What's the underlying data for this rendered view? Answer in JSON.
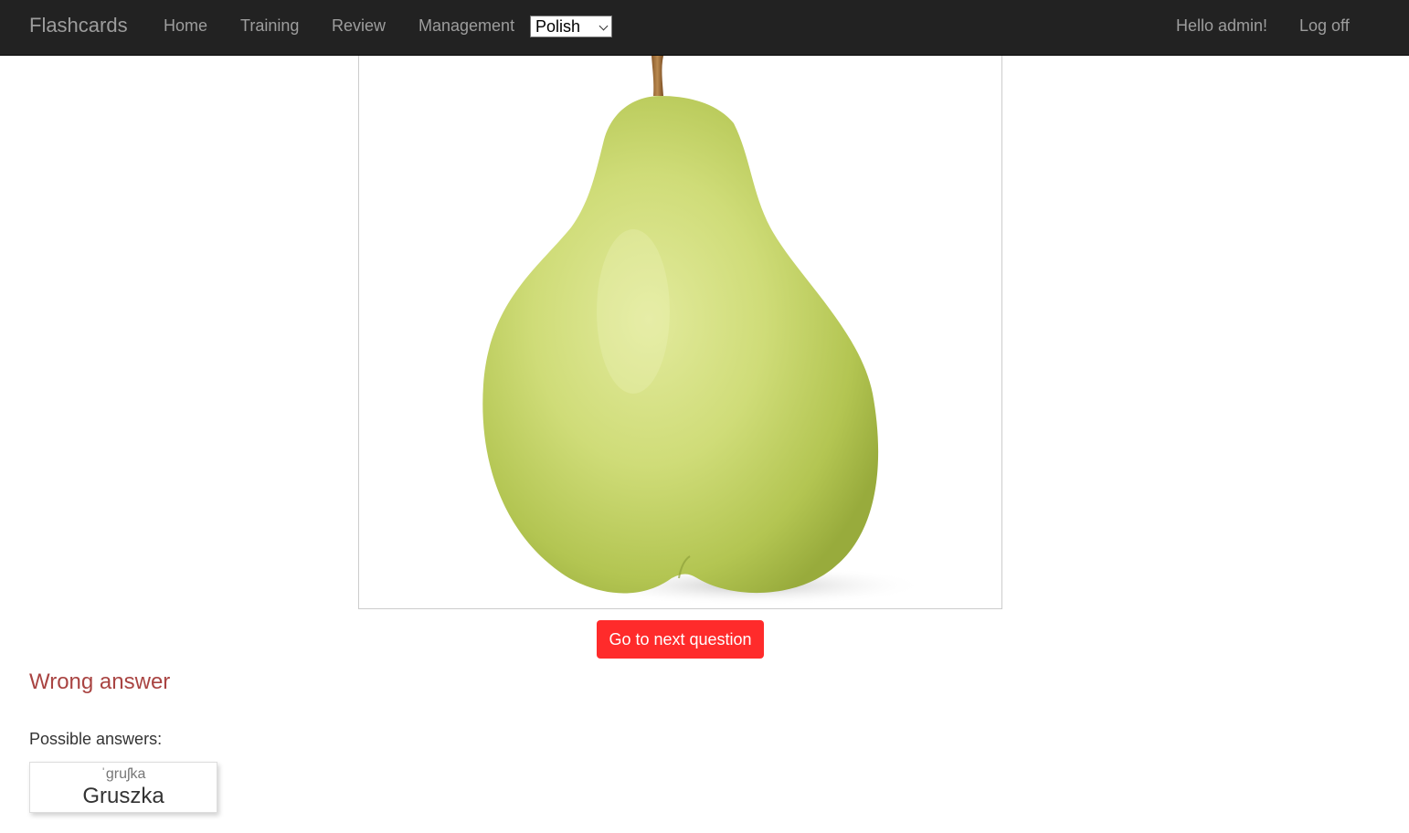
{
  "navbar": {
    "brand": "Flashcards",
    "links": [
      "Home",
      "Training",
      "Review",
      "Management"
    ],
    "language_selected": "Polish",
    "greeting": "Hello admin!",
    "logoff": "Log off"
  },
  "question": {
    "image_subject": "pear",
    "next_button": "Go to next question"
  },
  "result": {
    "status_text": "Wrong answer",
    "possible_answers_label": "Possible answers:",
    "answers": [
      {
        "pronunciation": "ˈɡruʃka",
        "word": "Gruszka"
      }
    ]
  },
  "colors": {
    "navbar_bg": "#222222",
    "nav_text": "#9d9d9d",
    "next_button_bg": "#ff2b2b",
    "wrong_text": "#a94442"
  }
}
